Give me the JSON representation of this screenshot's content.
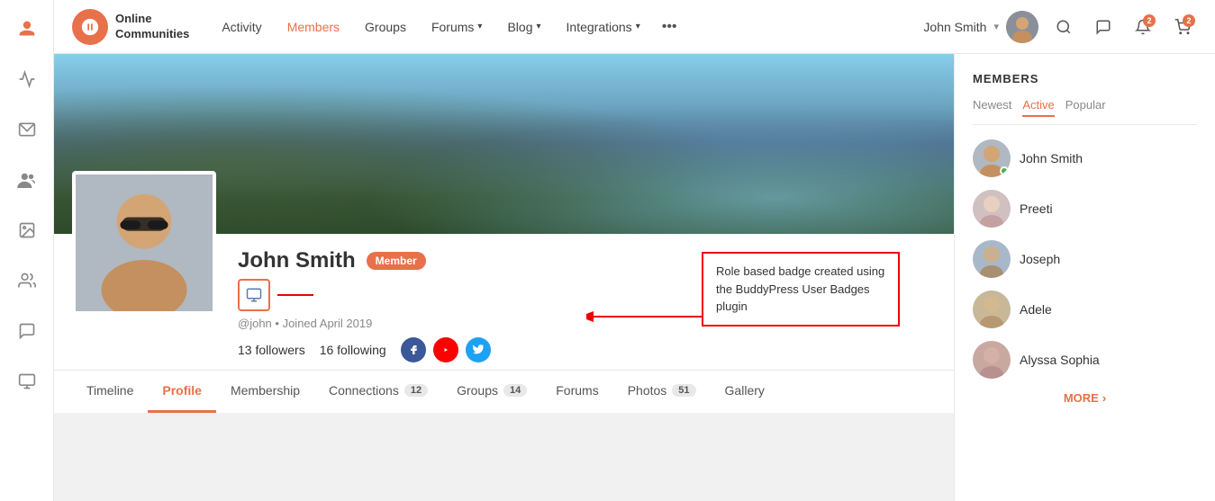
{
  "app": {
    "logo_letter": "b",
    "logo_title_line1": "Online",
    "logo_title_line2": "Communities"
  },
  "nav": {
    "links": [
      {
        "label": "Activity",
        "active": false
      },
      {
        "label": "Members",
        "active": true
      },
      {
        "label": "Groups",
        "active": false
      },
      {
        "label": "Forums",
        "active": false,
        "has_dropdown": true
      },
      {
        "label": "Blog",
        "active": false,
        "has_dropdown": true
      },
      {
        "label": "Integrations",
        "active": false,
        "has_dropdown": true
      }
    ],
    "more_label": "•••",
    "user_name": "John Smith",
    "notification_count": "2",
    "cart_count": "2"
  },
  "profile": {
    "name": "John Smith",
    "badge": "Member",
    "handle": "@john",
    "joined": "Joined April 2019",
    "followers": "13 followers",
    "following": "16 following",
    "annotation_title": "Role based badge created using the BuddyPress User Badges plugin"
  },
  "profile_tabs": [
    {
      "label": "Timeline",
      "active": false
    },
    {
      "label": "Profile",
      "active": true
    },
    {
      "label": "Membership",
      "active": false
    },
    {
      "label": "Connections",
      "active": false,
      "count": "12"
    },
    {
      "label": "Groups",
      "active": false,
      "count": "14"
    },
    {
      "label": "Forums",
      "active": false
    },
    {
      "label": "Photos",
      "active": false,
      "count": "51"
    },
    {
      "label": "Gallery",
      "active": false
    }
  ],
  "sidebar": {
    "section_title": "MEMBERS",
    "tabs": [
      {
        "label": "Newest",
        "active": false
      },
      {
        "label": "Active",
        "active": true
      },
      {
        "label": "Popular",
        "active": false
      }
    ],
    "members": [
      {
        "name": "John Smith",
        "online": true,
        "face_class": "face-john"
      },
      {
        "name": "Preeti",
        "online": false,
        "face_class": "face-preeti"
      },
      {
        "name": "Joseph",
        "online": false,
        "face_class": "face-joseph"
      },
      {
        "name": "Adele",
        "online": false,
        "face_class": "face-adele"
      },
      {
        "name": "Alyssa Sophia",
        "online": false,
        "face_class": "face-alyssa"
      }
    ],
    "more_label": "MORE"
  },
  "left_icons": [
    {
      "name": "user-icon",
      "symbol": "👤",
      "active": true
    },
    {
      "name": "activity-icon",
      "symbol": "⚡",
      "active": false
    },
    {
      "name": "envelope-icon",
      "symbol": "✉",
      "active": false
    },
    {
      "name": "group-icon",
      "symbol": "👥",
      "active": false
    },
    {
      "name": "image-icon",
      "symbol": "🖼",
      "active": false
    },
    {
      "name": "contacts-icon",
      "symbol": "🧑‍🤝‍🧑",
      "active": false
    },
    {
      "name": "chat-icon",
      "symbol": "💬",
      "active": false
    },
    {
      "name": "monitor-icon",
      "symbol": "🖥",
      "active": false
    }
  ]
}
